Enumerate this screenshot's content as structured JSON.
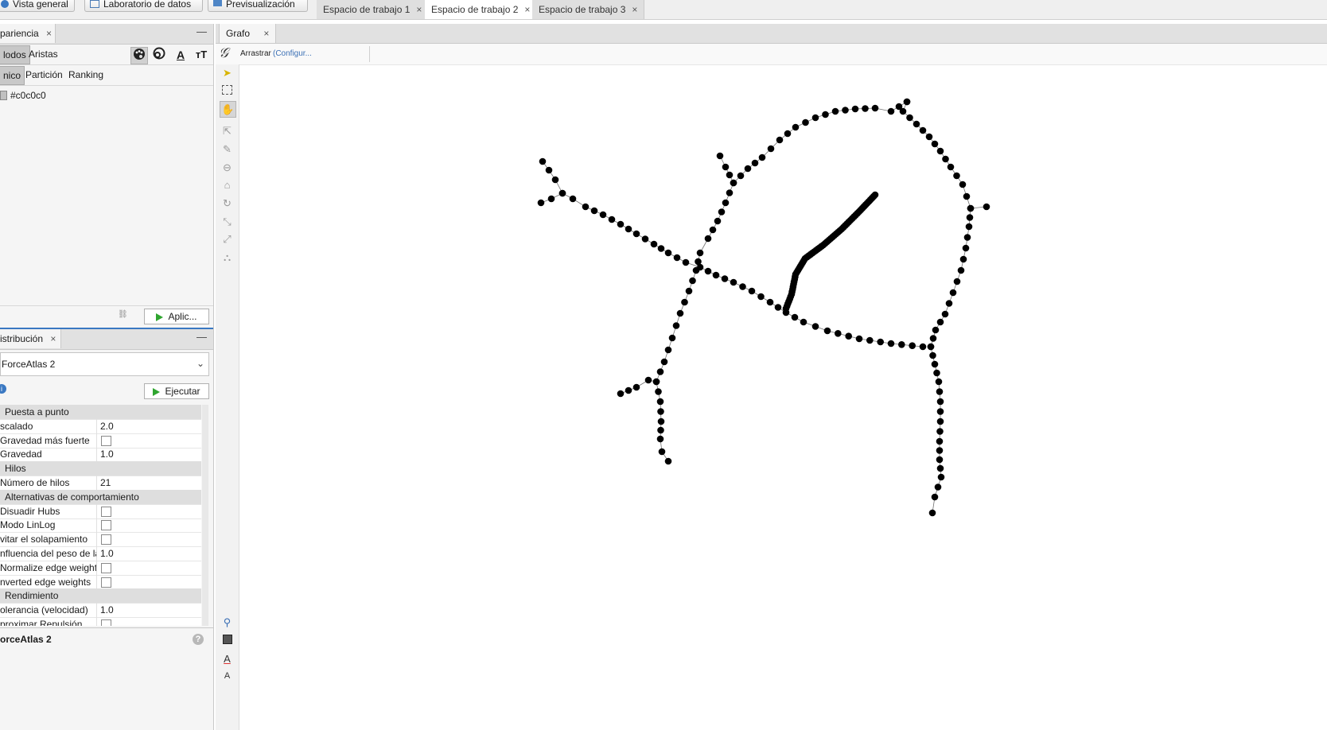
{
  "topbar": {
    "buttons": [
      {
        "label": "Vista general",
        "icon": "globe-icon"
      },
      {
        "label": "Laboratorio de datos",
        "icon": "table-icon"
      },
      {
        "label": "Previsualización",
        "icon": "monitor-icon"
      }
    ],
    "workspace_tabs": [
      {
        "label": "Espacio de trabajo 1",
        "active": false
      },
      {
        "label": "Espacio de trabajo 2",
        "active": true
      },
      {
        "label": "Espacio de trabajo 3",
        "active": false
      }
    ],
    "close_glyph": "×"
  },
  "appearance": {
    "tab_label": "pariencia",
    "close_glyph": "×",
    "minimize_glyph": "—",
    "element_tabs": [
      "lodos",
      "Aristas"
    ],
    "mode_tabs": [
      "nico",
      "Partición",
      "Ranking"
    ],
    "toolbar_icons": [
      "palette-icon",
      "size-icon",
      "label-color-icon",
      "label-size-icon"
    ],
    "color_value": "#c0c0c0",
    "apply_label": "Aplic...",
    "accent_color": "#2fa52f"
  },
  "layout": {
    "tab_label": "istribución",
    "close_glyph": "×",
    "minimize_glyph": "—",
    "algorithm": "ForceAtlas 2",
    "run_label": "Ejecutar",
    "properties": [
      {
        "type": "section",
        "label": "Puesta a punto"
      },
      {
        "type": "value",
        "label": "scalado",
        "value": "2.0"
      },
      {
        "type": "check",
        "label": "Gravedad más fuerte"
      },
      {
        "type": "value",
        "label": "Gravedad",
        "value": "1.0"
      },
      {
        "type": "section",
        "label": "Hilos"
      },
      {
        "type": "value",
        "label": "Número de hilos",
        "value": "21"
      },
      {
        "type": "section",
        "label": "Alternativas de comportamiento"
      },
      {
        "type": "check",
        "label": "Disuadir Hubs"
      },
      {
        "type": "check",
        "label": "Modo LinLog"
      },
      {
        "type": "check",
        "label": "vitar el solapamiento"
      },
      {
        "type": "value",
        "label": "nfluencia del peso de las",
        "value": "1.0"
      },
      {
        "type": "check",
        "label": "Normalize edge weights"
      },
      {
        "type": "check",
        "label": "nverted edge weights"
      },
      {
        "type": "section",
        "label": "Rendimiento"
      },
      {
        "type": "value",
        "label": "olerancia (velocidad)",
        "value": "1.0"
      },
      {
        "type": "check",
        "label": "proximar Repulsión"
      }
    ],
    "description_title": "orceAtlas 2",
    "help_glyph": "?"
  },
  "graph": {
    "tab_label": "Grafo",
    "close_glyph": "×",
    "tool_label": "Arrastrar",
    "config_label": "(Configur...",
    "node_color": "#000000",
    "edge_color": "#707070"
  }
}
